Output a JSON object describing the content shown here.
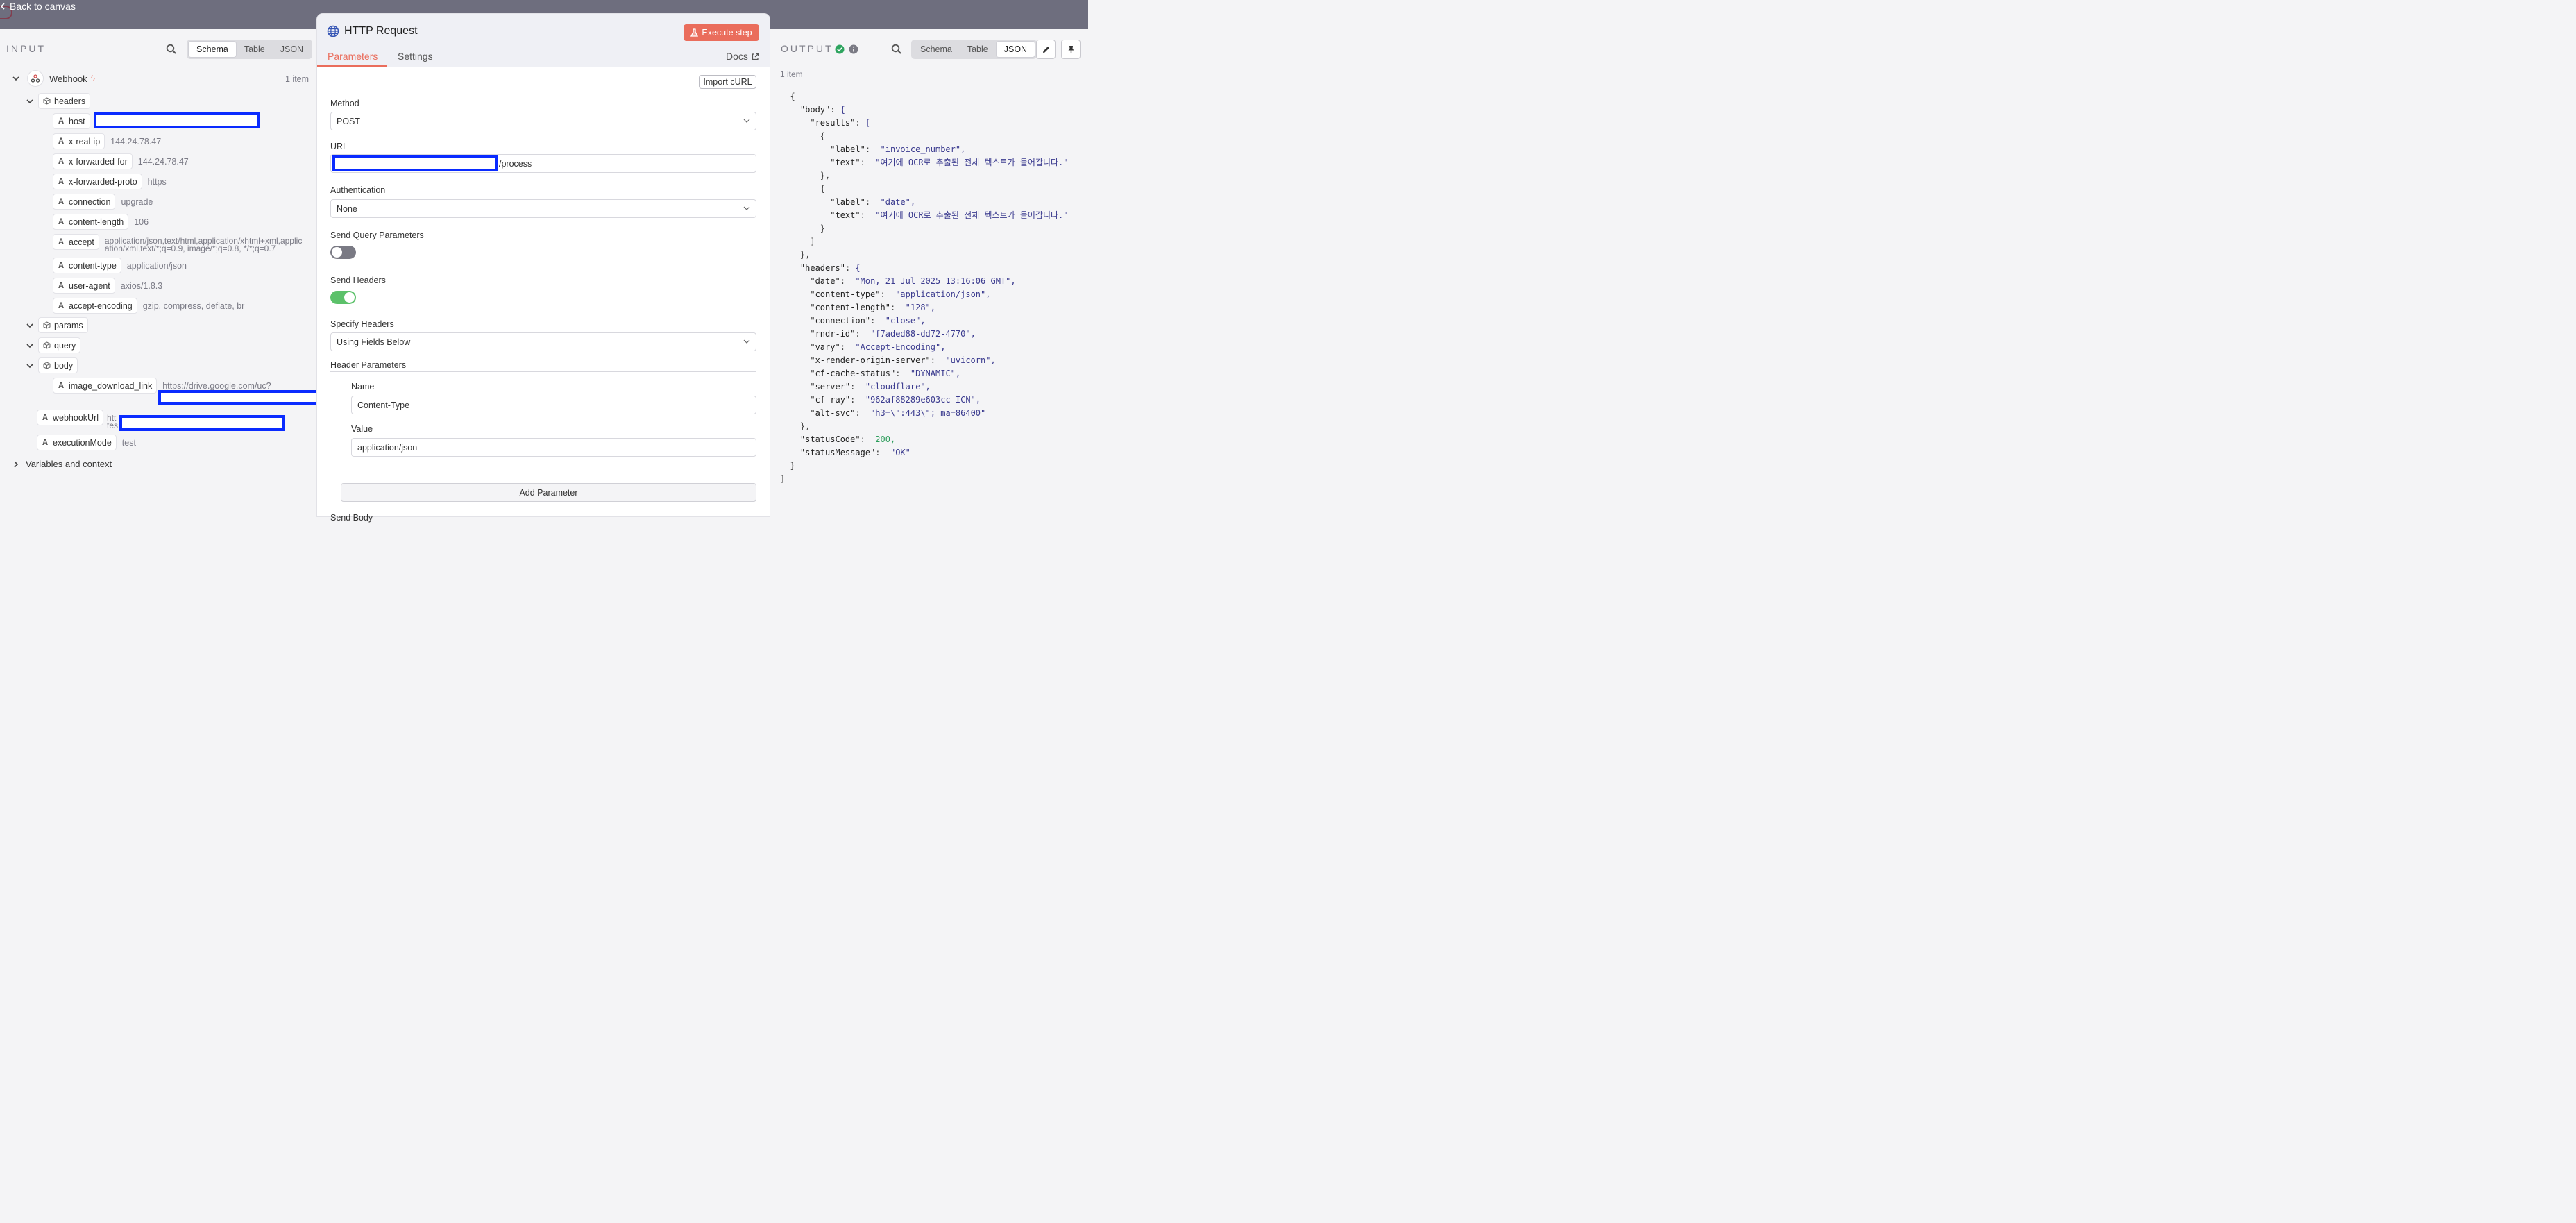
{
  "topbar": {
    "back_label": "Back to canvas"
  },
  "input": {
    "title": "INPUT",
    "view_tabs": [
      "Schema",
      "Table",
      "JSON"
    ],
    "active_tab": "Schema",
    "root": {
      "name": "Webhook",
      "count": "1 item"
    },
    "headers_label": "headers",
    "headers": [
      {
        "key": "host",
        "value": ""
      },
      {
        "key": "x-real-ip",
        "value": "144.24.78.47"
      },
      {
        "key": "x-forwarded-for",
        "value": "144.24.78.47"
      },
      {
        "key": "x-forwarded-proto",
        "value": "https"
      },
      {
        "key": "connection",
        "value": "upgrade"
      },
      {
        "key": "content-length",
        "value": "106"
      },
      {
        "key": "accept",
        "value": "application/json,text/html,application/xhtml+xml,applic",
        "value2": "ation/xml,text/*;q=0.9, image/*;q=0.8, */*;q=0.7"
      },
      {
        "key": "content-type",
        "value": "application/json"
      },
      {
        "key": "user-agent",
        "value": "axios/1.8.3"
      },
      {
        "key": "accept-encoding",
        "value": "gzip, compress, deflate, br"
      }
    ],
    "params_label": "params",
    "query_label": "query",
    "body_label": "body",
    "body_field": {
      "key": "image_download_link",
      "value": "https://drive.google.com/uc?"
    },
    "webhook_url": {
      "key": "webhookUrl",
      "value": "htt",
      "value2": "tes"
    },
    "execution_mode": {
      "key": "executionMode",
      "value": "test"
    },
    "variables_label": "Variables and context"
  },
  "modal": {
    "title": "HTTP Request",
    "execute_label": "Execute step",
    "tabs": [
      "Parameters",
      "Settings"
    ],
    "docs_label": "Docs",
    "import_curl": "Import cURL",
    "method_label": "Method",
    "method_value": "POST",
    "url_label": "URL",
    "url_suffix": "/process",
    "auth_label": "Authentication",
    "auth_value": "None",
    "send_query_label": "Send Query Parameters",
    "send_query_on": false,
    "send_headers_label": "Send Headers",
    "send_headers_on": true,
    "specify_headers_label": "Specify Headers",
    "specify_headers_value": "Using Fields Below",
    "header_params_label": "Header Parameters",
    "name_label": "Name",
    "name_value": "Content-Type",
    "value_label": "Value",
    "value_value": "application/json",
    "add_param_label": "Add Parameter",
    "send_body_label": "Send Body"
  },
  "output": {
    "title": "OUTPUT",
    "view_tabs": [
      "Schema",
      "Table",
      "JSON"
    ],
    "active_tab": "JSON",
    "count": "1 item",
    "json_lines": [
      "[",
      "  {",
      "    \"body\": {",
      "      \"results\": [",
      "        {",
      "          \"label\":  \"invoice_number\",",
      "          \"text\":  \"여기에 OCR로 추출된 전체 텍스트가 들어갑니다.\"",
      "        },",
      "        {",
      "          \"label\":  \"date\",",
      "          \"text\":  \"여기에 OCR로 추출된 전체 텍스트가 들어갑니다.\"",
      "        }",
      "      ]",
      "    },",
      "    \"headers\": {",
      "      \"date\":  \"Mon, 21 Jul 2025 13:16:06 GMT\",",
      "      \"content-type\":  \"application/json\",",
      "      \"content-length\":  \"128\",",
      "      \"connection\":  \"close\",",
      "      \"rndr-id\":  \"f7aded88-dd72-4770\",",
      "      \"vary\":  \"Accept-Encoding\",",
      "      \"x-render-origin-server\":  \"uvicorn\",",
      "      \"cf-cache-status\":  \"DYNAMIC\",",
      "      \"server\":  \"cloudflare\",",
      "      \"cf-ray\":  \"962af88289e603cc-ICN\",",
      "      \"alt-svc\":  \"h3=\\\":443\\\"; ma=86400\"",
      "    },",
      "    \"statusCode\":  200,",
      "    \"statusMessage\":  \"OK\"",
      "  }",
      "]"
    ]
  },
  "colors": {
    "accent": "#ea6d5c",
    "toggle_on": "#5cc16a",
    "toggle_off": "#7a7a84",
    "redact": "#0a2bff"
  }
}
